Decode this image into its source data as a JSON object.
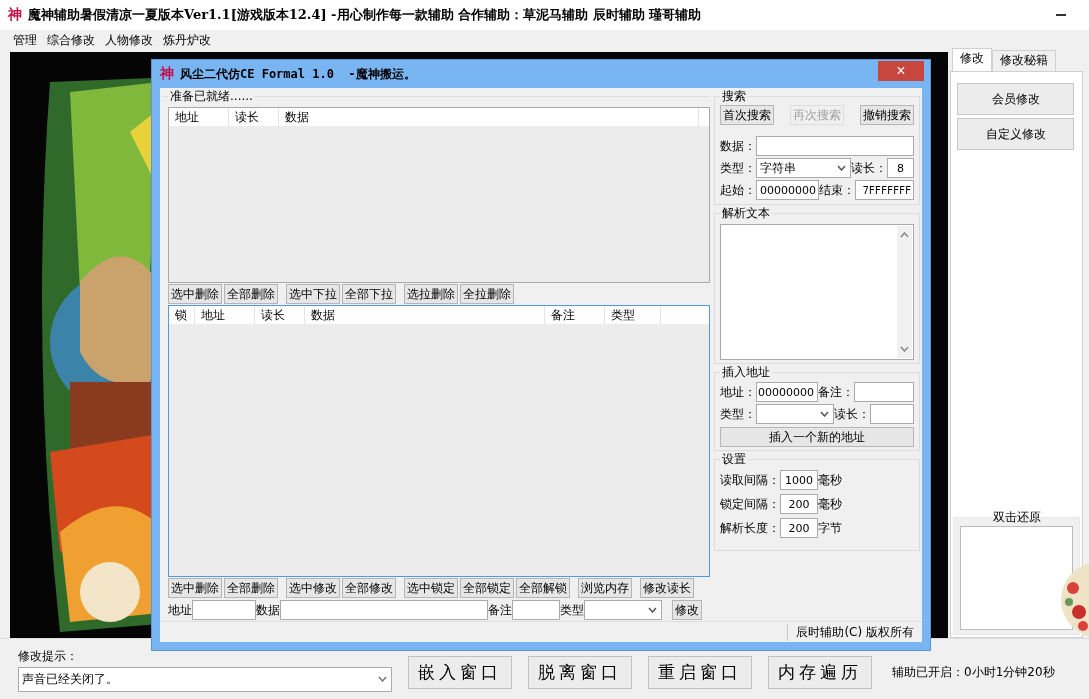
{
  "window": {
    "icon": "神",
    "title": "魔神辅助暑假清凉一夏版本Ver1.1[游戏版本12.4] -用心制作每一款辅助  合作辅助：草泥马辅助  辰时辅助  瑾哥辅助"
  },
  "menu": [
    "管理",
    "综合修改",
    "人物修改",
    "炼丹炉改"
  ],
  "dialog": {
    "icon": "神",
    "title": "风尘二代仿CE Formal 1.0  -魔神搬运。",
    "close": "×",
    "results": {
      "legend": "准备已就绪......",
      "columns": [
        "地址",
        "读长",
        "数据"
      ]
    },
    "result_buttons": [
      [
        "选中删除",
        "全部删除"
      ],
      [
        "选中下拉",
        "全部下拉"
      ],
      [
        "选拉删除",
        "全拉删除"
      ]
    ],
    "locked_list": {
      "columns": [
        "锁",
        "地址",
        "读长",
        "数据",
        "备注",
        "类型"
      ]
    },
    "list_buttons": [
      [
        "选中删除",
        "全部删除"
      ],
      [
        "选中修改",
        "全部修改"
      ],
      [
        "选中锁定",
        "全部锁定",
        "全部解锁"
      ],
      [
        "浏览内存"
      ],
      [
        "修改读长"
      ]
    ],
    "edit_row": {
      "address_label": "地址",
      "data_label": "数据",
      "note_label": "备注",
      "type_label": "类型",
      "button": "修改"
    },
    "search": {
      "legend": "搜索",
      "buttons": [
        {
          "label": "首次搜索",
          "disabled": false
        },
        {
          "label": "再次搜索",
          "disabled": true
        },
        {
          "label": "撤销搜索",
          "disabled": false
        }
      ],
      "data_label": "数据：",
      "type_label": "类型：",
      "type_value": "字符串",
      "length_label": "读长：",
      "length_value": "8",
      "start_label": "起始：",
      "start_value": "00000000",
      "end_label": "结束：",
      "end_value": "7FFFFFFF"
    },
    "parse": {
      "legend": "解析文本"
    },
    "insert": {
      "legend": "插入地址",
      "address_label": "地址：",
      "address_value": "00000000",
      "note_label": "备注：",
      "type_label": "类型：",
      "length_label": "读长：",
      "button": "插入一个新的地址"
    },
    "settings": {
      "legend": "设置",
      "rows": [
        {
          "label": "读取间隔：",
          "value": "1000",
          "unit": "毫秒"
        },
        {
          "label": "锁定间隔：",
          "value": "200",
          "unit": "毫秒"
        },
        {
          "label": "解析长度：",
          "value": "200",
          "unit": "字节"
        }
      ]
    },
    "status": "辰时辅助(C) 版权所有"
  },
  "side": {
    "tabs": [
      {
        "label": "修改",
        "selected": true
      },
      {
        "label": "修改秘籍",
        "selected": false
      }
    ],
    "buttons": [
      "会员修改",
      "自定义修改"
    ],
    "restore_legend": "双击还原"
  },
  "bottom": {
    "hint_label": "修改提示：",
    "hint_value": "声音已经关闭了。",
    "buttons": [
      "嵌入窗口",
      "脱离窗口",
      "重启窗口",
      "内存遍历"
    ],
    "status": "辅助已开启：0小时1分钟20秒"
  }
}
